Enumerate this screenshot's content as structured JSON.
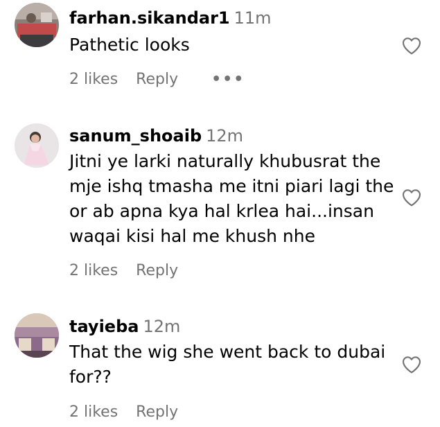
{
  "comments": [
    {
      "username": "farhan.sikandar1",
      "time": "11m",
      "text": "Pathetic looks",
      "likes": "2 likes",
      "reply": "Reply",
      "more": "•••",
      "avatar_icon": "user-avatar-icon",
      "like_icon": "heart-outline-icon"
    },
    {
      "username": "sanum_shoaib",
      "time": "12m",
      "text": "Jitni ye larki naturally khubusrat the mje ishq tmasha me itni piari lagi the or ab apna kya hal krlea hai...insan waqai kisi hal me khush nhe",
      "likes": "2 likes",
      "reply": "Reply",
      "avatar_icon": "user-avatar-icon",
      "like_icon": "heart-outline-icon"
    },
    {
      "username": "tayieba",
      "time": "12m",
      "text": "That the wig she went back to dubai for??",
      "likes": "2 likes",
      "reply": "Reply",
      "avatar_icon": "user-avatar-icon",
      "like_icon": "heart-outline-icon"
    }
  ],
  "colors": {
    "text": "#000000",
    "secondary": "#737373",
    "background": "#ffffff"
  }
}
